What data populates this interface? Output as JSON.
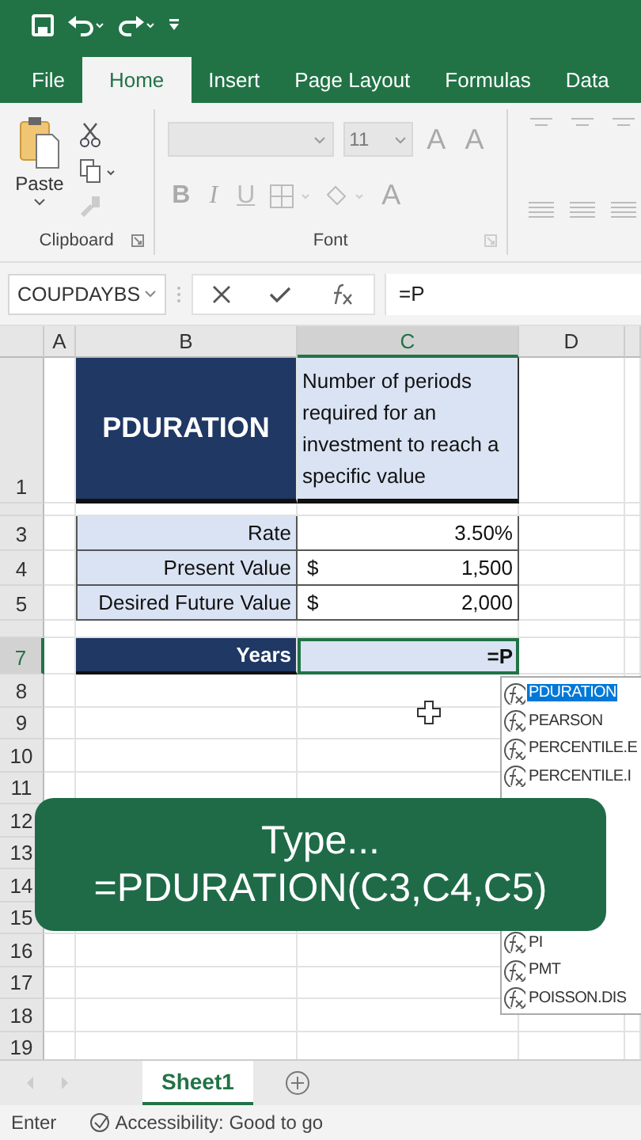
{
  "tabs": [
    {
      "label": "File",
      "selected": false
    },
    {
      "label": "Home",
      "selected": true
    },
    {
      "label": "Insert",
      "selected": false
    },
    {
      "label": "Page Layout",
      "selected": false
    },
    {
      "label": "Formulas",
      "selected": false
    },
    {
      "label": "Data",
      "selected": false
    }
  ],
  "ribbon": {
    "paste_label": "Paste",
    "clipboard_label": "Clipboard",
    "font_size": "11",
    "size_buttons": [
      "A",
      "A"
    ],
    "style_buttons": [
      "B",
      "I",
      "U"
    ],
    "font_color_button": "A",
    "font_label": "Font"
  },
  "formula_bar": {
    "name_box": "COUPDAYBS",
    "formula": "=P"
  },
  "columns": [
    {
      "label": "A",
      "selected": false
    },
    {
      "label": "B",
      "selected": false
    },
    {
      "label": "C",
      "selected": true
    },
    {
      "label": "D",
      "selected": false
    }
  ],
  "rows": [
    {
      "header": "1",
      "selected": false,
      "b": {
        "kind": "title",
        "text": "PDURATION"
      },
      "c": {
        "kind": "note",
        "text": "Number of periods required for an investment to reach a specific value"
      }
    },
    {
      "selected": false
    },
    {
      "header": "3",
      "selected": false,
      "b": {
        "kind": "label",
        "text": "Rate"
      },
      "c": {
        "kind": "number",
        "text": "3.50%"
      }
    },
    {
      "header": "4",
      "selected": false,
      "b": {
        "kind": "label",
        "text": "Present Value"
      },
      "c": {
        "kind": "currency",
        "symbol": "$",
        "text": "1,500"
      }
    },
    {
      "header": "5",
      "selected": false,
      "b": {
        "kind": "label",
        "text": "Desired Future Value"
      },
      "c": {
        "kind": "currency",
        "symbol": "$",
        "text": "2,000"
      }
    },
    {
      "selected": false
    },
    {
      "header": "7",
      "selected": true,
      "b": {
        "kind": "result",
        "text": "Years"
      },
      "c": {
        "kind": "editing",
        "text": "=P"
      }
    },
    {
      "header": "8",
      "selected": false
    },
    {
      "header": "9",
      "selected": false
    },
    {
      "header": "10",
      "selected": false
    },
    {
      "header": "11",
      "selected": false
    },
    {
      "header": "12",
      "selected": false
    },
    {
      "header": "13",
      "selected": false
    },
    {
      "header": "14",
      "selected": false
    },
    {
      "header": "15",
      "selected": false
    },
    {
      "header": "16",
      "selected": false
    },
    {
      "header": "17",
      "selected": false
    },
    {
      "header": "18",
      "selected": false
    },
    {
      "header": "19",
      "selected": false
    }
  ],
  "autocomplete": {
    "top": [
      {
        "label": "PDURATION",
        "selected": true
      },
      {
        "label": "PEARSON",
        "selected": false
      },
      {
        "label": "PERCENTILE.E",
        "selected": false
      },
      {
        "label": "PERCENTILE.I",
        "selected": false
      }
    ],
    "bottom": [
      {
        "label": "PI",
        "selected": false
      },
      {
        "label": "PMT",
        "selected": false
      },
      {
        "label": "POISSON.DIS",
        "selected": false
      }
    ]
  },
  "caption": [
    "Type...",
    "=PDURATION(C3,C4,C5)"
  ],
  "sheet_tabs": [
    {
      "label": "Sheet1",
      "selected": true
    }
  ],
  "status_bar": {
    "mode": "Enter",
    "accessibility": "Accessibility: Good to go"
  }
}
